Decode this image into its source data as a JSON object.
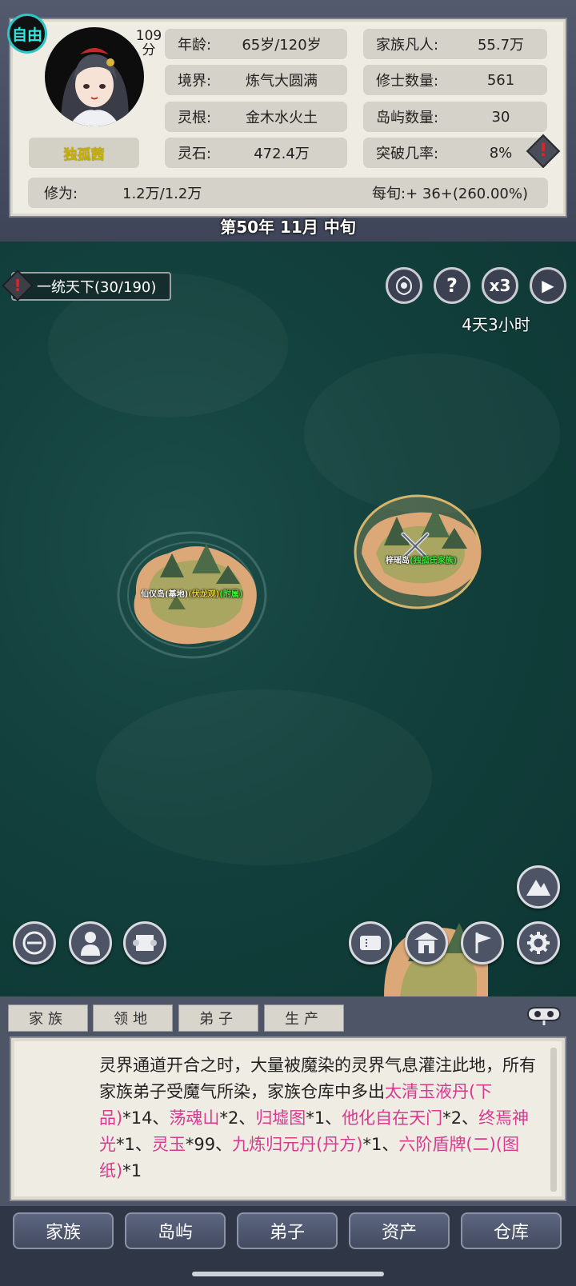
{
  "header": {
    "status_badge": "自由",
    "score_value": "109",
    "score_unit": "分",
    "character_name": "独孤茜",
    "stats": {
      "age": {
        "label": "年龄:",
        "value": "65岁/120岁"
      },
      "realm": {
        "label": "境界:",
        "value": "炼气大圆满"
      },
      "spirit_root": {
        "label": "灵根:",
        "value": "金木水火土"
      },
      "spirit_stone": {
        "label": "灵石:",
        "value": "472.4万"
      },
      "family_mortals": {
        "label": "家族凡人:",
        "value": "55.7万"
      },
      "cultivators": {
        "label": "修士数量:",
        "value": "561"
      },
      "islands": {
        "label": "岛屿数量:",
        "value": "30"
      },
      "breakthrough": {
        "label": "突破几率:",
        "value": "8%"
      },
      "cultivation": {
        "label": "修为:",
        "value": "1.2万/1.2万"
      },
      "per_period": {
        "label": "每旬:",
        "value": "+ 36+(260.00%)"
      }
    },
    "warn_glyph": "!",
    "date": "第50年 11月 中旬"
  },
  "map": {
    "quest_label": "一统天下(30/190)",
    "speed_label": "x3",
    "help_label": "?",
    "play_label": "▶",
    "timer": "4天3小时",
    "islands": [
      {
        "name": "仙仪岛",
        "tag1": "(基地)",
        "tag2": "(伏龙观)",
        "tag3": "(附属)"
      },
      {
        "name": "梓瑶岛",
        "tag1": "(独孤氏家族)"
      }
    ]
  },
  "panel": {
    "tabs": [
      "家族",
      "领地",
      "弟子",
      "生产"
    ],
    "log": {
      "t1": "灵界通道开合之时，大量被魔染的灵界气息灌注此地，所有家族弟子受魔气所染，家族仓库中多出",
      "i1": "太清玉液丹(下品)",
      "t2": "*14、",
      "i2": "荡魂山",
      "t3": "*2、",
      "i3": "归墟图",
      "t4": "*1、",
      "i4": "他化自在天门",
      "t5": "*2、",
      "i5": "终焉神光",
      "t6": "*1、",
      "i6": "灵玉",
      "t7": "*99、",
      "i7": "九炼归元丹(丹方)",
      "t8": "*1、",
      "i8": "六阶盾牌(二)(图纸)",
      "t9": "*1"
    }
  },
  "nav": [
    "家族",
    "岛屿",
    "弟子",
    "资产",
    "仓库"
  ]
}
